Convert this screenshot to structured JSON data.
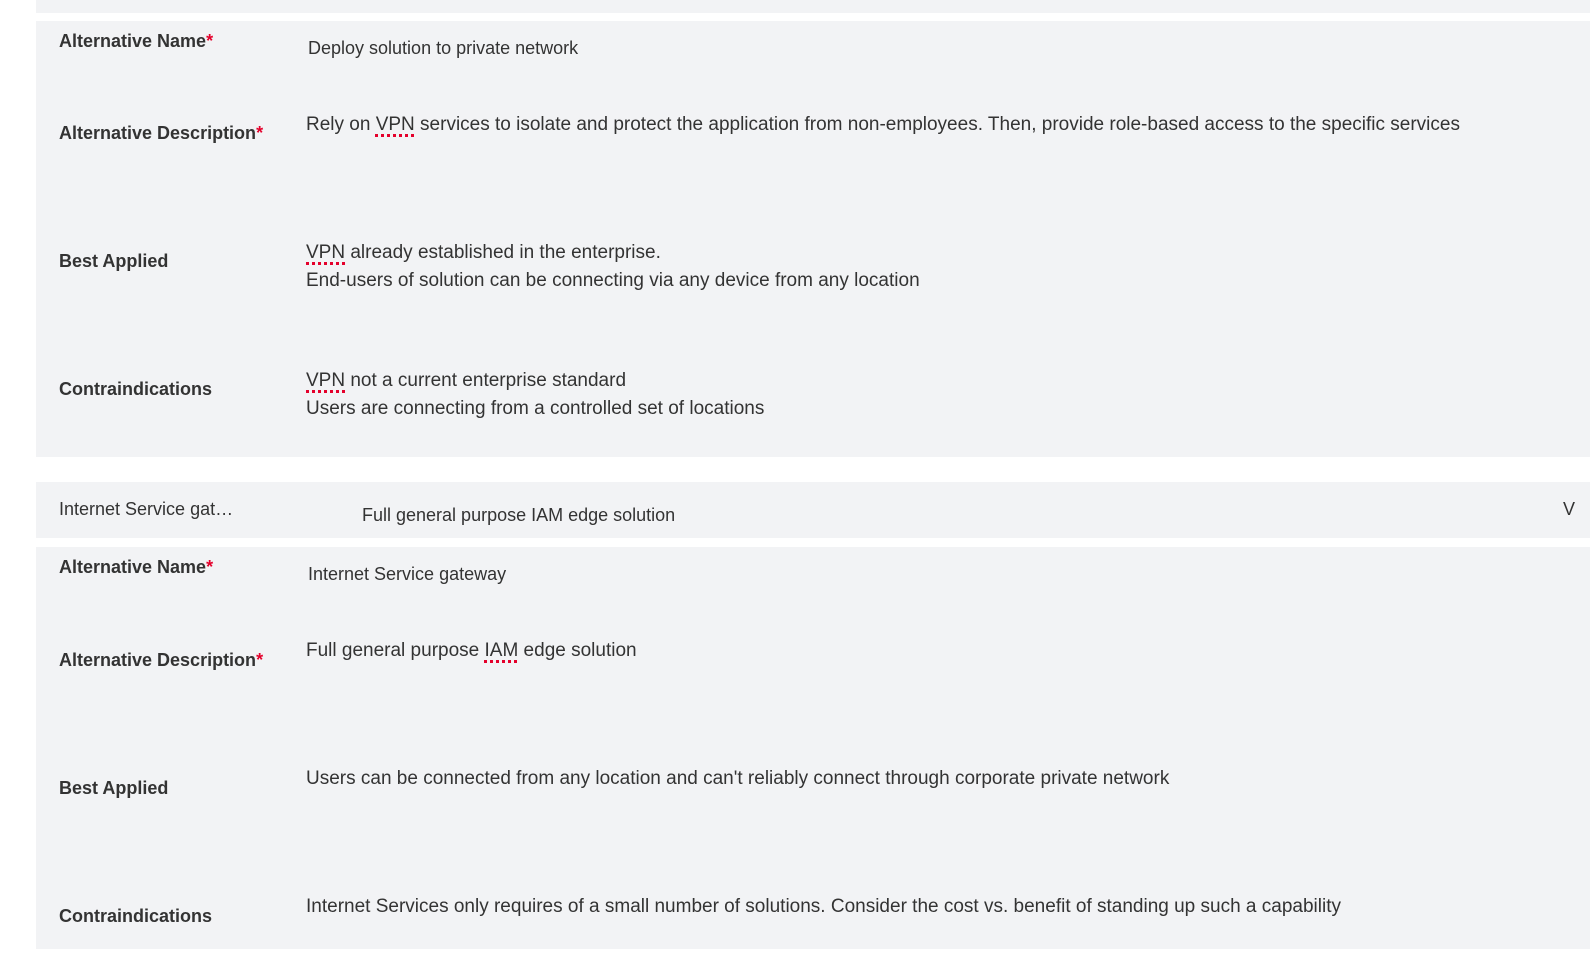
{
  "alternative_1": {
    "name_label": "Alternative Name",
    "name_required": "*",
    "name_value": "Deploy solution to private network",
    "description_label": "Alternative Description",
    "description_required": "*",
    "description_parts": [
      "Rely on ",
      "VPN",
      " services to isolate and protect the application from non-employees. Then, provide role-based access to the specific services"
    ],
    "best_applied_label": "Best Applied",
    "best_applied_parts": [
      "VPN",
      " already established in the enterprise.\nEnd-users of solution can be connecting via any device from any location"
    ],
    "contraindications_label": "Contraindications",
    "contraindications_parts": [
      "VPN",
      " not a current enterprise standard\nUsers are connecting from a controlled set of locations"
    ]
  },
  "summary_row": {
    "name": "Internet Service gat…",
    "description": "Full general purpose IAM edge solution",
    "edge_text": "V"
  },
  "alternative_2": {
    "name_label": "Alternative Name",
    "name_required": "*",
    "name_value": "Internet Service gateway",
    "description_label": "Alternative Description",
    "description_required": "*",
    "description_parts": [
      "Full general purpose ",
      "IAM",
      " edge solution"
    ],
    "best_applied_label": "Best Applied",
    "best_applied_value": "Users can be connected from any location and can't reliably connect through corporate private network",
    "contraindications_label": "Contraindications",
    "contraindications_value": "Internet Services only requires of a small number of solutions. Consider the cost vs. benefit of standing up such a capability"
  },
  "colors": {
    "panel_background": "#f2f3f5",
    "required_marker": "#e4002b",
    "text": "#333333"
  }
}
